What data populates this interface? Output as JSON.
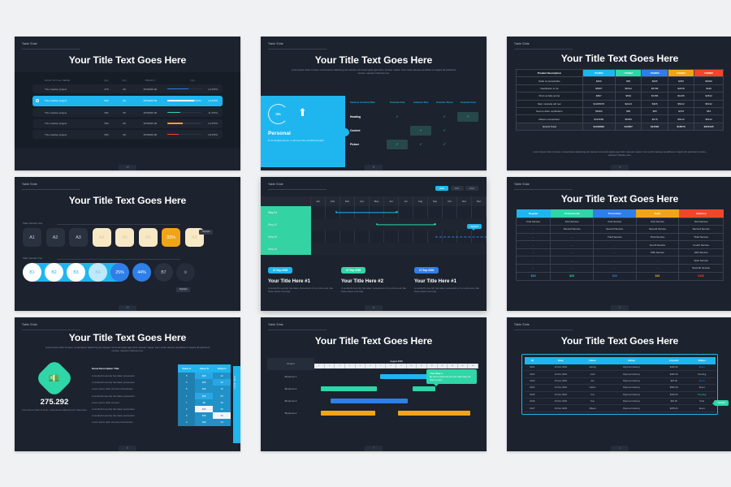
{
  "common": {
    "eyebrow": "Table Slide",
    "eyebrow_alt": "Table Slide",
    "title": "Your Title Text Goes Here",
    "lorem": "Lorem ipsum dolor sit amet, consectetuer adipiscing elit. Aenean commodo ligula eget dolor. Aenean massa. Cum sociis natoque penatibus et magnis dis parturient montes, nascetur ridiculus mus.",
    "colors": {
      "cyan": "#1fb6f0",
      "green": "#2fd6a7",
      "blue": "#2f7fe8",
      "amber": "#f0a518",
      "red": "#f2462a",
      "slide_bg": "#1c222e"
    }
  },
  "slide1": {
    "page": "10",
    "columns": [
      "DATA STYLE HERE",
      "(%)",
      "(%)",
      "PROFIT",
      "(%)"
    ],
    "rows": [
      {
        "name": "The creative project",
        "v1": "270",
        "v2": "90",
        "profit": "$752000.00",
        "pct": "12.375%",
        "fill": 62,
        "color": "#2f7fe8",
        "state": "normal"
      },
      {
        "name": "The creative project",
        "v1": "530",
        "v2": "80",
        "profit": "$752000.00",
        "pct": "12.375%",
        "fill": 78,
        "color": "#ffffff",
        "state": "selected"
      },
      {
        "name": "The creative project",
        "v1": "250",
        "v2": "90",
        "profit": "$752000.00",
        "pct": "11.375%",
        "fill": 38,
        "color": "#2fd6a7",
        "state": "normal"
      },
      {
        "name": "The creative project",
        "v1": "250",
        "v2": "90",
        "profit": "$752000.00",
        "pct": "14.375%",
        "fill": 46,
        "color": "#f0a518",
        "state": "normal"
      },
      {
        "name": "The creative project",
        "v1": "250",
        "v2": "90",
        "profit": "$752000.00",
        "pct": "10.375%",
        "fill": 32,
        "color": "#f2462a",
        "state": "normal"
      }
    ]
  },
  "slide2": {
    "page": "8",
    "percent": "78%",
    "panel_title": "Personal",
    "panel_text": "To an English person, it will seem like simplified English.",
    "columns": [
      "Various Content Title",
      "Column One",
      "Column Two",
      "Column Three",
      "Column Four"
    ],
    "rows": [
      {
        "label": "Heading",
        "cells": [
          "check",
          "",
          "check",
          "check-box"
        ]
      },
      {
        "label": "Content",
        "cells": [
          "",
          "check-box",
          "check",
          ""
        ]
      },
      {
        "label": "Picture",
        "cells": [
          "check-box",
          "check",
          "check",
          ""
        ]
      }
    ]
  },
  "slide3": {
    "page": "3",
    "columns": [
      "Product Description",
      "ITEM01",
      "ITEM02",
      "ITEM03",
      "ITEM04",
      "ITEM05"
    ],
    "header_colors": [
      "#1a202a",
      "#1fb6f0",
      "#2fd6a7",
      "#2f7fe8",
      "#f0a518",
      "#f2462a"
    ],
    "rows": [
      {
        "desc": "Nulla ut perspiciatis",
        "values": [
          "$200",
          "$50",
          "$365",
          "$456",
          "$6000"
        ]
      },
      {
        "desc": "Vestibulum in ha",
        "values": [
          "$5687",
          "$5412",
          "$6798",
          "$2678",
          "$426"
        ]
      },
      {
        "desc": "Proin at felis at nisi",
        "values": [
          "$897",
          "$562",
          "$7456",
          "$1235",
          "$4512"
        ]
      },
      {
        "desc": "Nam molestie elit nec",
        "values": [
          "$1025678",
          "$2123",
          "$365",
          "$5412",
          "$5412"
        ]
      },
      {
        "desc": "Sed eu diam vestibulum",
        "values": [
          "$5360",
          "$50",
          "$55",
          "$478",
          "$54"
        ]
      },
      {
        "desc": "Mauris consectetur",
        "values": [
          "$415660",
          "$5465",
          "$478",
          "$5412",
          "$5412"
        ]
      },
      {
        "desc": "Grand Total",
        "values": [
          "$1318932",
          "$13567",
          "$14500",
          "$16573",
          "$205135"
        ],
        "total": true
      }
    ]
  },
  "slide4": {
    "page": "10",
    "group_one_label": "Table Number One",
    "group_two_label": "Table Number Two",
    "highlight_label": "Highlight",
    "squares": [
      {
        "text": "A1",
        "style": "dark"
      },
      {
        "text": "A2",
        "style": "dark"
      },
      {
        "text": "A3",
        "style": "dark"
      },
      {
        "text": "A4",
        "style": "cream"
      },
      {
        "text": "A5",
        "style": "cream"
      },
      {
        "text": "A6",
        "style": "cream"
      },
      {
        "text": "33%",
        "style": "amber"
      },
      {
        "text": "A8",
        "style": "cream"
      }
    ],
    "circles": [
      {
        "text": "B1",
        "style": "white"
      },
      {
        "text": "B2",
        "style": "white"
      },
      {
        "text": "B3",
        "style": "white"
      },
      {
        "text": "B4",
        "style": "white-dim"
      },
      {
        "text": "25%",
        "style": "blue"
      },
      {
        "text": "44%",
        "style": "blue"
      },
      {
        "text": "B7",
        "style": "dark"
      },
      {
        "text": "gear-icon",
        "style": "dark-icon"
      }
    ]
  },
  "slide5": {
    "page": "6",
    "years": [
      "2020",
      "2021",
      "2022"
    ],
    "year_active": "2020",
    "months": [
      "Jan",
      "Feb",
      "Mar",
      "Apr",
      "May",
      "Jun",
      "Jul",
      "Aug",
      "Sep",
      "Oct",
      "Nov",
      "Dec"
    ],
    "steps": [
      "Step 01",
      "Step 02",
      "Step 03",
      "Step 04"
    ],
    "bars": [
      {
        "step": "Step 01",
        "start_pct": 11,
        "width_pct": 27,
        "color": "#1fb6f0",
        "dashed": false
      },
      {
        "step": "Step 02",
        "start_pct": 29,
        "width_pct": 26,
        "color": "#2fd6a7",
        "dashed": false
      },
      {
        "step": "Step 03",
        "start_pct": 55,
        "width_pct": 41,
        "color": "#2f7fe8",
        "dashed": true
      }
    ],
    "tooltip": "Highlight",
    "cards": [
      {
        "date": "27 Sep 2020",
        "date_color": "#1fb6f0",
        "heading": "Your Title Here #1",
        "text": "A wonderful serenity has taken possession of my entire soul, like these sweet mornings."
      },
      {
        "date": "27 Sep 2020",
        "date_color": "#2fd6a7",
        "heading": "Your Title Here #2",
        "text": "A wonderful serenity has taken possession of my entire soul, like these sweet mornings."
      },
      {
        "date": "27 Sep 2020",
        "date_color": "#2f7fe8",
        "heading": "Your Title Here #1",
        "text": "A wonderful serenity has taken possession of my entire soul, like these sweet mornings."
      }
    ]
  },
  "slide6": {
    "page": "2",
    "columns": [
      "Regular",
      "Professional",
      "Promotion",
      "Suite",
      "Advance"
    ],
    "header_colors": [
      "#1fb6f0",
      "#2fd6a7",
      "#2f7fe8",
      "#f0a518",
      "#f2462a"
    ],
    "rows": [
      [
        "First Service",
        "First Service",
        "First Service",
        "First Service",
        "First Service"
      ],
      [
        "-",
        "Second Service",
        "Second Service",
        "Second Service",
        "Second Service"
      ],
      [
        "-",
        "-",
        "Third Service",
        "Third Service",
        "Third Service"
      ],
      [
        "-",
        "-",
        "-",
        "Fourth Service",
        "Fourth Service"
      ],
      [
        "-",
        "-",
        "-",
        "Fifth Service",
        "Fifth Service"
      ],
      [
        "-",
        "-",
        "-",
        "-",
        "Sixth Service"
      ],
      [
        "-",
        "-",
        "-",
        "-",
        "Seventh Service"
      ]
    ],
    "prices": [
      "$15",
      "$29",
      "$39",
      "$49",
      "$100"
    ]
  },
  "slide7": {
    "page": "6",
    "icon": "money-hand-icon",
    "big_number": "275.292",
    "number_caption": "Lorem ipsum dolor sit amet, consectetuer adipiscing elit. Maecenas.",
    "side_tab": "2020 2021",
    "columns": [
      "Some Description Title",
      "Value A",
      "Value B",
      "Value C"
    ],
    "rows": [
      {
        "desc": "A wonderful serenity has taken possession",
        "a": "5",
        "b": "$25",
        "c": "12",
        "hl": "b"
      },
      {
        "desc": "A wonderful serenity has taken possession",
        "a": "5",
        "b": "$45",
        "c": "32",
        "hl": "c"
      },
      {
        "desc": "Lorem ipsum dolor sit amet consectetuer",
        "a": "5",
        "b": "$20",
        "c": "12",
        "hl": "none"
      },
      {
        "desc": "A wonderful serenity has taken possession",
        "a": "7",
        "b": "$60",
        "c": "50",
        "hl": "b"
      },
      {
        "desc": "Lorem ipsum dolor sit amet",
        "a": "7",
        "b": "$8",
        "c": "46",
        "hl": "none"
      },
      {
        "desc": "A wonderful serenity has taken possession",
        "a": "3",
        "b": "$23",
        "c": "30",
        "hl": "b-light"
      },
      {
        "desc": "A wonderful serenity has taken possession",
        "a": "3",
        "b": "$35",
        "c": "30",
        "hl": "c-light"
      },
      {
        "desc": "Lorem ipsum dolor sit amet consectetuer",
        "a": "3",
        "b": "$30",
        "c": "10",
        "hl": "none"
      }
    ]
  },
  "slide8": {
    "page": "7",
    "eyebrow": "Table Slide",
    "month_header": "August 2020",
    "ruler": [
      "1",
      "2",
      "3",
      "4",
      "5",
      "6",
      "7",
      "8",
      "9",
      "10",
      "11",
      "12",
      "13",
      "14",
      "15",
      "16"
    ],
    "project_label": "Project",
    "rows": [
      {
        "label": "Business 1",
        "bars": [
          {
            "start_pct": 40,
            "width_pct": 29,
            "color": "#1fb6f0"
          }
        ]
      },
      {
        "label": "Business 2",
        "bars": [
          {
            "start_pct": 4,
            "width_pct": 34,
            "color": "#2fd6a7"
          },
          {
            "start_pct": 60,
            "width_pct": 14,
            "color": "#2fd6a7"
          }
        ]
      },
      {
        "label": "Business 3",
        "bars": [
          {
            "start_pct": 10,
            "width_pct": 47,
            "color": "#2f7fe8"
          }
        ]
      },
      {
        "label": "Business 4",
        "bars": [
          {
            "start_pct": 4,
            "width_pct": 33,
            "color": "#f0a518"
          },
          {
            "start_pct": 51,
            "width_pct": 44,
            "color": "#f0a518"
          }
        ]
      }
    ],
    "tooltip_title": "Your Step 1",
    "tooltip_text": "Be sure to check out your own video blog, the three to come."
  },
  "slide9": {
    "page": "1",
    "eyebrow": "Table Slide",
    "columns": [
      "ID",
      "Date",
      "Name",
      "Detail",
      "Amount",
      "Status"
    ],
    "rows": [
      {
        "id": "#101",
        "date": "10 Nov 2020",
        "name": "Joining",
        "detail": "Payment delivery",
        "amount": "$420.00",
        "status": "Event",
        "status_color": "#2f7fe8"
      },
      {
        "id": "#102",
        "date": "10 Nov 2020",
        "name": "Josh",
        "detail": "Payment delivery",
        "amount": "$420.00",
        "status": "Pending",
        "status_color": "#b5bcc8"
      },
      {
        "id": "#103",
        "date": "10 Nov 2020",
        "name": "Joe",
        "detail": "Payment delivery",
        "amount": "$25.00",
        "status": "Event",
        "status_color": "#2f7fe8"
      },
      {
        "id": "#104",
        "date": "10 Nov 2020",
        "name": "Jobert",
        "detail": "Payment delivery",
        "amount": "$560.00",
        "status": "Event",
        "status_color": "#b5bcc8"
      },
      {
        "id": "#105",
        "date": "10 Nov 2020",
        "name": "Ann",
        "detail": "Payment delivery",
        "amount": "$425.00",
        "status": "Pending",
        "status_color": "#2fd6a7"
      },
      {
        "id": "#106",
        "date": "10 Nov 2020",
        "name": "Sue",
        "detail": "Payment delivery",
        "amount": "$46.00",
        "status": "Paid",
        "status_color": "#b5bcc8"
      },
      {
        "id": "#107",
        "date": "10 Nov 2020",
        "name": "Mikael",
        "detail": "Payment delivery",
        "amount": "$235.00",
        "status": "Event",
        "status_color": "#b5bcc8"
      }
    ],
    "tooltip": "Highlight"
  }
}
